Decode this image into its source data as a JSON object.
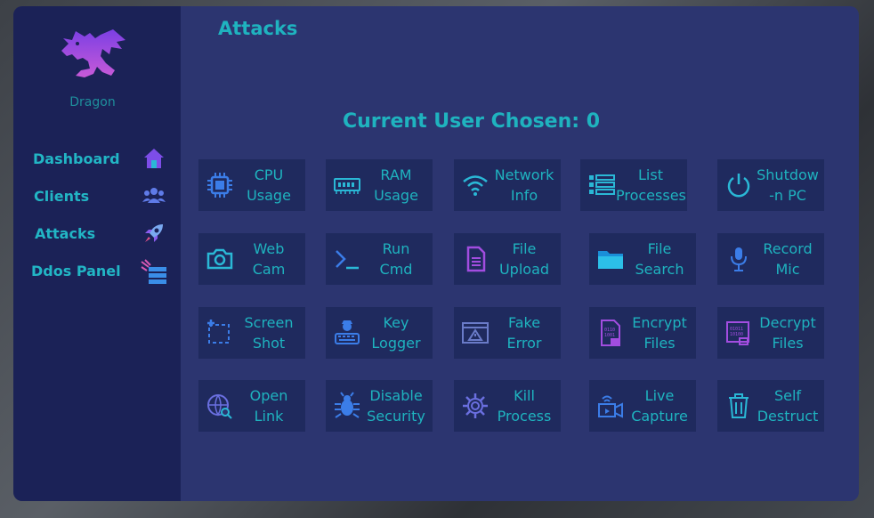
{
  "app": {
    "name": "Dragon",
    "page_title": "Attacks"
  },
  "sidebar": {
    "items": [
      {
        "label": "Dashboard",
        "icon": "home-icon"
      },
      {
        "label": "Clients",
        "icon": "users-icon"
      },
      {
        "label": "Attacks",
        "icon": "rocket-icon"
      },
      {
        "label": "Ddos Panel",
        "icon": "servers-icon"
      }
    ]
  },
  "main": {
    "current_user": "Current User Chosen: 0",
    "buttons": [
      {
        "line1": "CPU",
        "line2": "Usage",
        "icon": "cpu-icon"
      },
      {
        "line1": "RAM",
        "line2": "Usage",
        "icon": "ram-icon"
      },
      {
        "line1": "Network",
        "line2": "Info",
        "icon": "wifi-icon"
      },
      {
        "line1": "List",
        "line2": "Processes",
        "icon": "list-icon"
      },
      {
        "line1": "Shutdow",
        "line2": "-n PC",
        "icon": "power-icon"
      },
      {
        "line1": "Web",
        "line2": "Cam",
        "icon": "camera-icon"
      },
      {
        "line1": "Run",
        "line2": "Cmd",
        "icon": "terminal-icon"
      },
      {
        "line1": "File",
        "line2": "Upload",
        "icon": "file-icon"
      },
      {
        "line1": "File",
        "line2": "Search",
        "icon": "folder-icon"
      },
      {
        "line1": "Record",
        "line2": "Mic",
        "icon": "microphone-icon"
      },
      {
        "line1": "Screen",
        "line2": "Shot",
        "icon": "screenshot-icon"
      },
      {
        "line1": "Key",
        "line2": "Logger",
        "icon": "keylogger-icon"
      },
      {
        "line1": "Fake",
        "line2": "Error",
        "icon": "warning-window-icon"
      },
      {
        "line1": "Encrypt",
        "line2": "Files",
        "icon": "encrypt-file-icon"
      },
      {
        "line1": "Decrypt",
        "line2": "Files",
        "icon": "decrypt-file-icon"
      },
      {
        "line1": "Open",
        "line2": "Link",
        "icon": "globe-search-icon"
      },
      {
        "line1": "Disable",
        "line2": "Security",
        "icon": "bug-icon"
      },
      {
        "line1": "Kill",
        "line2": "Process",
        "icon": "gear-icon"
      },
      {
        "line1": "Live",
        "line2": "Capture",
        "icon": "video-camera-icon"
      },
      {
        "line1": "Self",
        "line2": "Destruct",
        "icon": "trash-icon"
      }
    ]
  },
  "colors": {
    "accent": "#1fb3bf",
    "sidebar": "#1b2257",
    "panel": "#2c3570",
    "button": "#1f2a5e"
  }
}
